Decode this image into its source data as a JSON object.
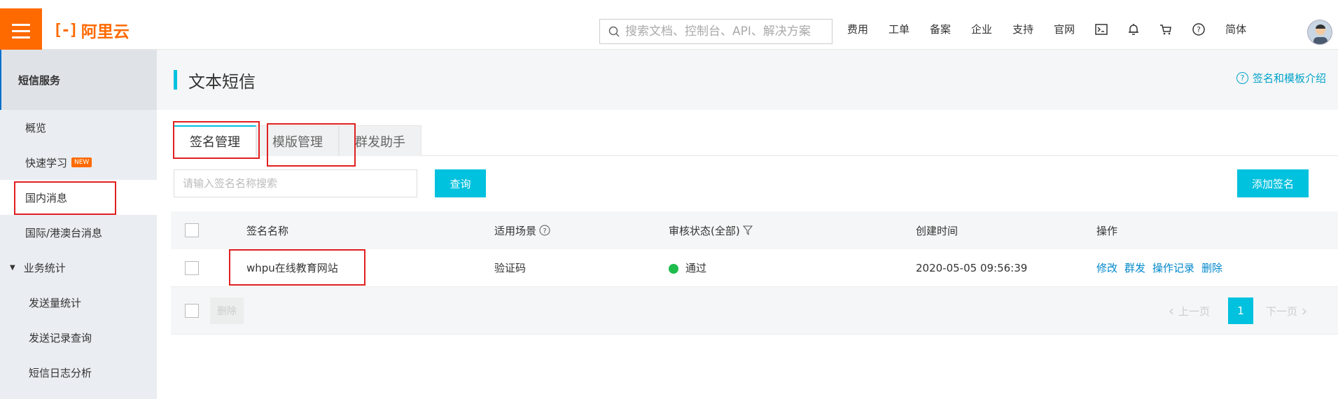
{
  "header": {
    "logo_text": "阿里云",
    "search_placeholder": "搜索文档、控制台、API、解决方案",
    "nav": [
      "费用",
      "工单",
      "备案",
      "企业",
      "支持",
      "官网"
    ],
    "language": "简体"
  },
  "sidebar": {
    "title": "短信服务",
    "items": [
      {
        "label": "概览"
      },
      {
        "label": "快速学习",
        "badge": "NEW"
      },
      {
        "label": "国内消息"
      },
      {
        "label": "国际/港澳台消息"
      },
      {
        "label": "业务统计"
      },
      {
        "label": "发送量统计"
      },
      {
        "label": "发送记录查询"
      },
      {
        "label": "短信日志分析"
      }
    ]
  },
  "main": {
    "title": "文本短信",
    "help_link": "签名和模板介绍",
    "tabs": [
      "签名管理",
      "模版管理",
      "群发助手"
    ],
    "search_placeholder": "请输入签名名称搜索",
    "query_button": "查询",
    "add_button": "添加签名",
    "table": {
      "columns": [
        "签名名称",
        "适用场景",
        "审核状态(全部)",
        "创建时间",
        "操作"
      ],
      "rows": [
        {
          "name": "whpu在线教育网站",
          "scene": "验证码",
          "status": "通过",
          "created": "2020-05-05 09:56:39",
          "actions": [
            "修改",
            "群发",
            "操作记录",
            "删除"
          ]
        }
      ]
    },
    "footer": {
      "delete_button": "删除",
      "prev_page": "上一页",
      "current_page": "1",
      "next_page": "下一页"
    }
  },
  "colors": {
    "brand": "#ff6a00",
    "accent": "#00c1de",
    "link": "#0088cc",
    "status_ok": "#1ebc4c",
    "highlight": "#e02020"
  }
}
